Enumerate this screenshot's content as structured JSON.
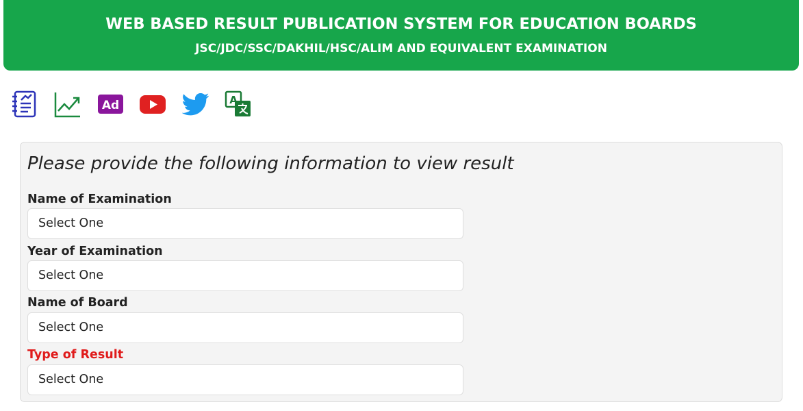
{
  "header": {
    "title": "WEB BASED RESULT PUBLICATION SYSTEM FOR EDUCATION BOARDS",
    "subtitle": "JSC/JDC/SSC/DAKHIL/HSC/ALIM AND EQUIVALENT EXAMINATION",
    "bg_color": "#17a64b"
  },
  "toolbar": {
    "icons": [
      "notice-list-icon",
      "statistics-chart-icon",
      "ad-icon",
      "youtube-icon",
      "twitter-icon",
      "translate-icon"
    ],
    "ad_label": "Ad"
  },
  "form": {
    "heading": "Please provide the following information to view result",
    "fields": [
      {
        "label": "Name of Examination",
        "value": "Select One"
      },
      {
        "label": "Year of Examination",
        "value": "Select One"
      },
      {
        "label": "Name of Board",
        "value": "Select One"
      },
      {
        "label": "Type of Result",
        "value": "Select One",
        "label_color": "#e01b1b"
      }
    ]
  }
}
